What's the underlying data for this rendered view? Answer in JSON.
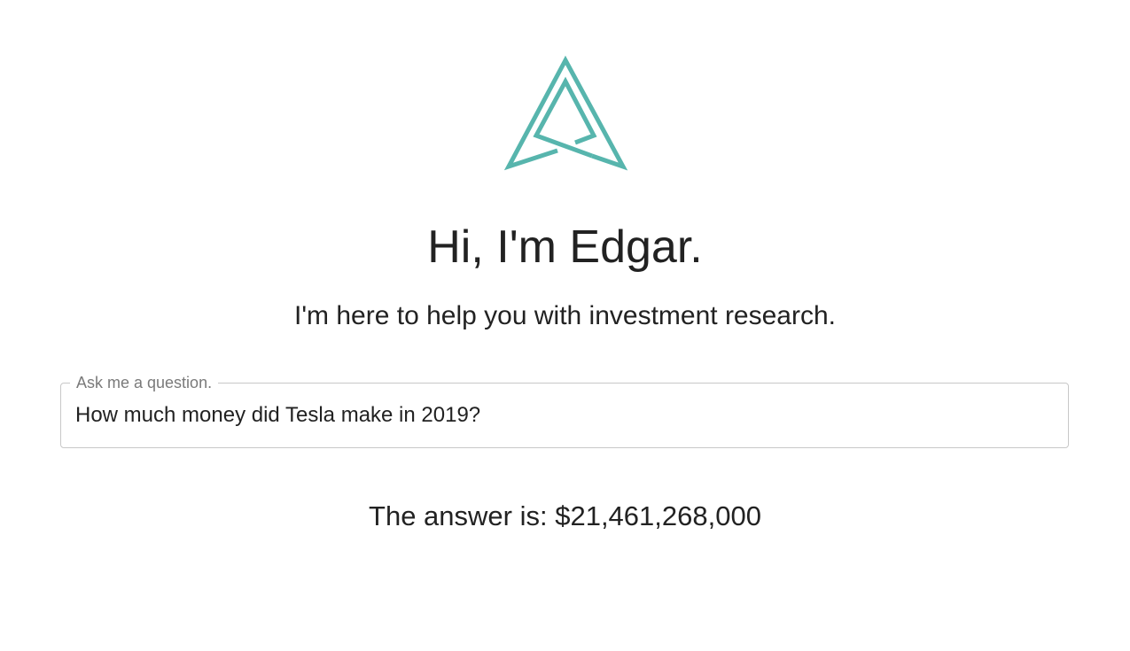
{
  "brand": {
    "logo_icon": "edgar-triangle-logo-icon",
    "accent_color": "#57b5ad"
  },
  "hero": {
    "greeting": "Hi, I'm Edgar.",
    "tagline": "I'm here to help you with investment research."
  },
  "question_field": {
    "label": "Ask me a question.",
    "value": "How much money did Tesla make in 2019?"
  },
  "result": {
    "answer_text": "The answer is: $21,461,268,000"
  }
}
